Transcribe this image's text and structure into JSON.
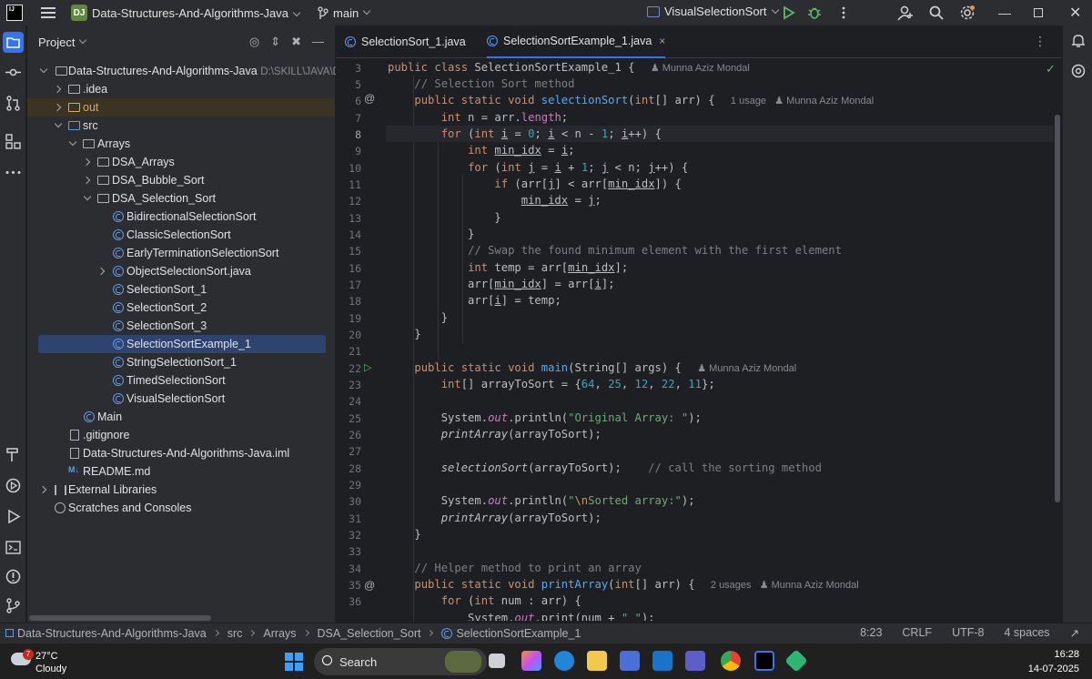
{
  "titlebar": {
    "project_badge": "DJ",
    "project_name": "Data-Structures-And-Algorithms-Java",
    "branch": "main",
    "run_config": "VisualSelectionSort"
  },
  "project_panel": {
    "title": "Project",
    "tree": [
      {
        "label": "Data-Structures-And-Algorithms-Java",
        "hint": "D:\\SKILL\\JAVA\\D:",
        "icon": "folder-icon",
        "expanded": true
      },
      {
        "label": ".idea",
        "icon": "folder-icon"
      },
      {
        "label": "out",
        "icon": "folder-icon"
      },
      {
        "label": "src",
        "icon": "folder-icon",
        "expanded": true
      },
      {
        "label": "Arrays",
        "icon": "package-icon",
        "expanded": true
      },
      {
        "label": "DSA_Arrays",
        "icon": "package-icon"
      },
      {
        "label": "DSA_Bubble_Sort",
        "icon": "package-icon"
      },
      {
        "label": "DSA_Selection_Sort",
        "icon": "package-icon",
        "expanded": true
      },
      {
        "label": "BidirectionalSelectionSort",
        "icon": "class-icon"
      },
      {
        "label": "ClassicSelectionSort",
        "icon": "class-icon"
      },
      {
        "label": "EarlyTerminationSelectionSort",
        "icon": "class-icon"
      },
      {
        "label": "ObjectSelectionSort.java",
        "icon": "class-icon"
      },
      {
        "label": "SelectionSort_1",
        "icon": "class-icon"
      },
      {
        "label": "SelectionSort_2",
        "icon": "class-icon"
      },
      {
        "label": "SelectionSort_3",
        "icon": "class-icon"
      },
      {
        "label": "SelectionSortExample_1",
        "icon": "class-icon",
        "selected": true
      },
      {
        "label": "StringSelectionSort_1",
        "icon": "class-icon"
      },
      {
        "label": "TimedSelectionSort",
        "icon": "class-icon"
      },
      {
        "label": "VisualSelectionSort",
        "icon": "class-icon"
      },
      {
        "label": "Main",
        "icon": "class-icon"
      },
      {
        "label": ".gitignore",
        "icon": "file-icon"
      },
      {
        "label": "Data-Structures-And-Algorithms-Java.iml",
        "icon": "file-icon"
      },
      {
        "label": "README.md",
        "icon": "markdown-icon"
      },
      {
        "label": "External Libraries",
        "icon": "library-icon"
      },
      {
        "label": "Scratches and Consoles",
        "icon": "scratches-icon"
      }
    ]
  },
  "editor": {
    "tabs": [
      {
        "label": "SelectionSort_1.java"
      },
      {
        "label": "SelectionSortExample_1.java",
        "active": true
      }
    ],
    "close_glyph": "×",
    "author": "Munna Aziz Mondal",
    "usage_1": "1 usage",
    "usage_2": "2 usages",
    "line_numbers": [
      "3",
      "5",
      "6",
      "7",
      "8",
      "9",
      "10",
      "11",
      "12",
      "13",
      "14",
      "15",
      "16",
      "17",
      "18",
      "19",
      "20",
      "21",
      "22",
      "23",
      "24",
      "25",
      "26",
      "27",
      "28",
      "29",
      "30",
      "31",
      "32",
      "33",
      "34",
      "35",
      "36"
    ],
    "current_line": "8"
  },
  "statusbar": {
    "breadcrumbs": [
      "Data-Structures-And-Algorithms-Java",
      "src",
      "Arrays",
      "DSA_Selection_Sort",
      "SelectionSortExample_1"
    ],
    "position": "8:23",
    "line_sep": "CRLF",
    "encoding": "UTF-8",
    "indent": "4 spaces"
  },
  "taskbar": {
    "weather_badge": "7",
    "temp": "27°C",
    "condition": "Cloudy",
    "search_placeholder": "Search",
    "time": "16:28",
    "date": "14-07-2025"
  }
}
